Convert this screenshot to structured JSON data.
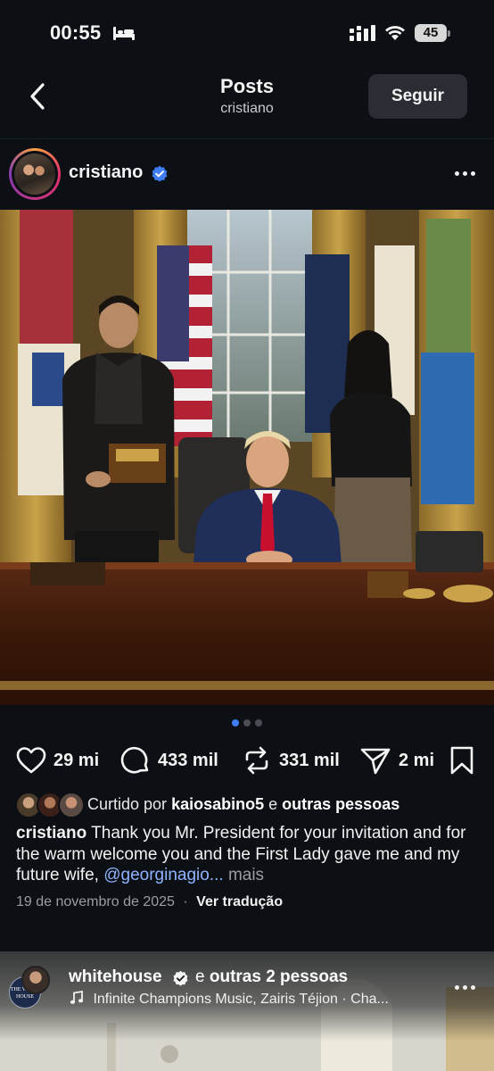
{
  "status_bar": {
    "time": "00:55",
    "battery": "45"
  },
  "nav": {
    "title": "Posts",
    "subtitle": "cristiano",
    "follow_label": "Seguir"
  },
  "post": {
    "username": "cristiano",
    "media_pages": 3,
    "media_active_page": 1,
    "likes": "29 mi",
    "comments": "433 mil",
    "reposts": "331 mil",
    "shares": "2 mi",
    "liked_by_prefix": "Curtido por",
    "liked_by_user": "kaiosabino5",
    "liked_by_conj": "e",
    "liked_by_others": "outras pessoas",
    "caption_user": "cristiano",
    "caption_text": "Thank you Mr. President for your invitation and for the warm welcome you and the First Lady gave me and my future wife,",
    "caption_mention": "@georginagio...",
    "caption_more": "mais",
    "date": "19 de novembro de 2025",
    "separator": "·",
    "translate_label": "Ver tradução"
  },
  "next_post": {
    "avatar_text": "THE WHITE HOUSE",
    "username": "whitehouse",
    "others_conj": "e",
    "others": "outras 2 pessoas",
    "music": "Infinite Champions Music, Zairis Téjion · Cha..."
  },
  "colors": {
    "background": "#0c0f14",
    "verified": "#3f7cf6",
    "follow_button": "#2a2d33",
    "mention": "#8fb4ff",
    "muted_text": "#9a9da3"
  }
}
